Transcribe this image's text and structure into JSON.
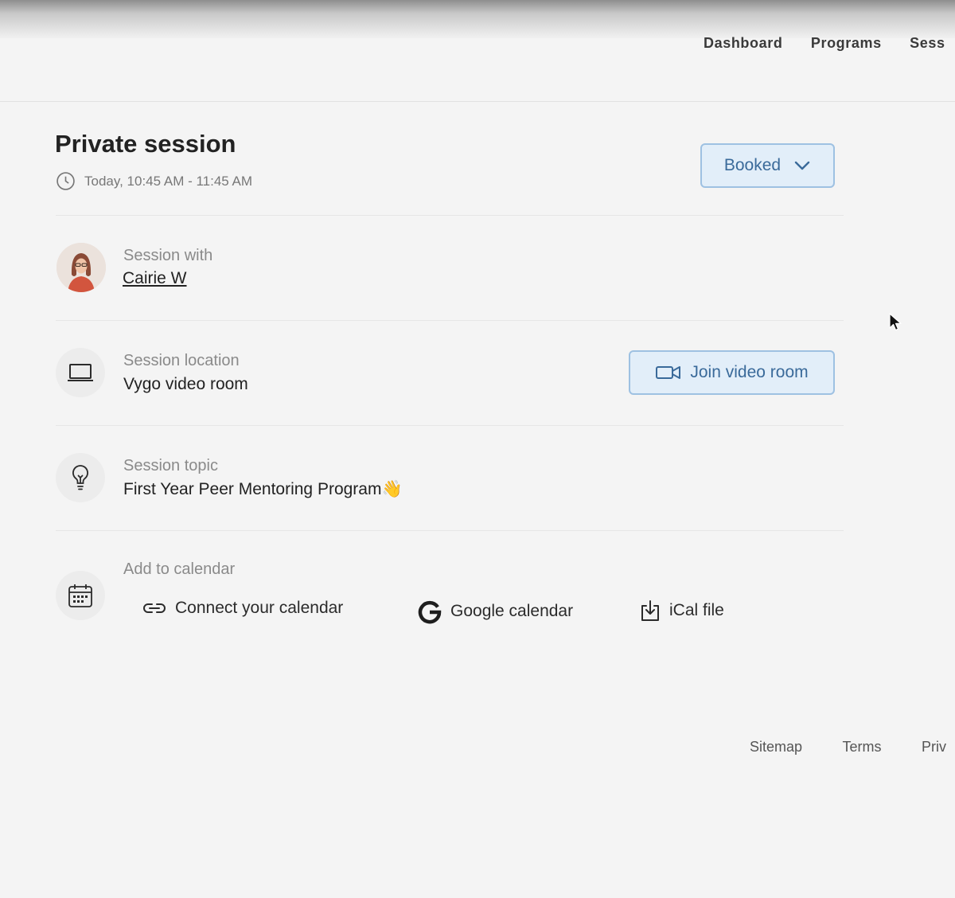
{
  "nav": {
    "items": [
      "Dashboard",
      "Programs",
      "Sess"
    ]
  },
  "session": {
    "title": "Private session",
    "time": "Today, 10:45 AM - 11:45 AM",
    "status_label": "Booked"
  },
  "with": {
    "label": "Session with",
    "name": "Cairie W"
  },
  "location": {
    "label": "Session location",
    "value": "Vygo video room",
    "join_label": "Join video room"
  },
  "topic": {
    "label": "Session topic",
    "value": "First Year Peer Mentoring Program",
    "emoji": "👋"
  },
  "calendar": {
    "label": "Add to calendar",
    "links": [
      "Connect your calendar",
      "Google calendar",
      "iCal file"
    ]
  },
  "footer": {
    "items": [
      "Sitemap",
      "Terms",
      "Priv"
    ]
  },
  "colors": {
    "accent_bg": "#e2eef9",
    "accent_border": "#9ec1e2",
    "accent_text": "#3a6a9a"
  },
  "icons": [
    "clock-icon",
    "chevron-down-icon",
    "laptop-icon",
    "video-camera-icon",
    "lightbulb-icon",
    "calendar-icon",
    "link-icon",
    "google-icon",
    "download-icon",
    "cursor-icon"
  ]
}
